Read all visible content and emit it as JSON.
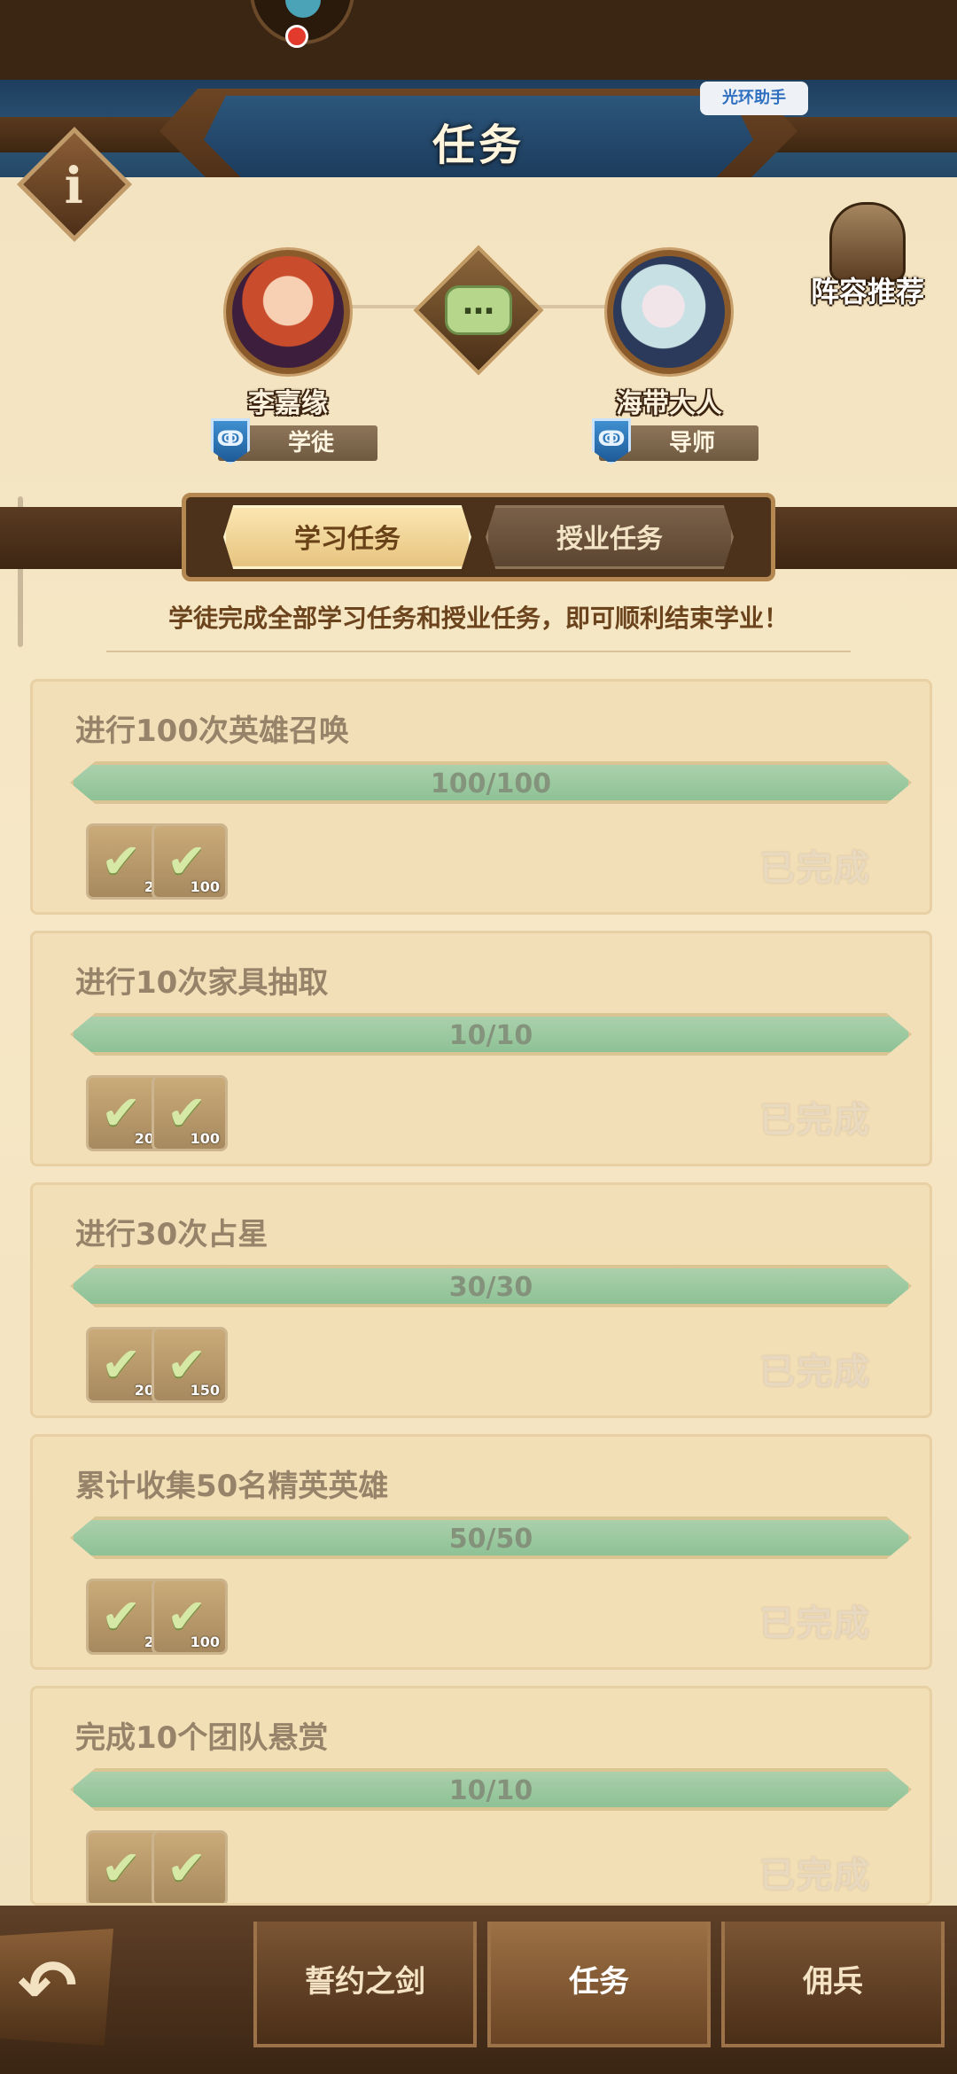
{
  "header": {
    "title": "任务",
    "helper_label": "光环助手",
    "lineup_label": "阵容推荐"
  },
  "apprentice": {
    "name": "李嘉缘",
    "role": "学徒"
  },
  "mentor": {
    "name": "海带大人",
    "role": "导师"
  },
  "tabs": [
    {
      "label": "学习任务",
      "active": true
    },
    {
      "label": "授业任务",
      "active": false
    }
  ],
  "subtitle": "学徒完成全部学习任务和授业任务，即可顺利结束学业！",
  "tasks": [
    {
      "name": "进行100次英雄召唤",
      "progress": "100/100",
      "rewards": [
        "2",
        "100"
      ],
      "status": "已完成"
    },
    {
      "name": "进行10次家具抽取",
      "progress": "10/10",
      "rewards": [
        "20",
        "100"
      ],
      "status": "已完成"
    },
    {
      "name": "进行30次占星",
      "progress": "30/30",
      "rewards": [
        "20",
        "150"
      ],
      "status": "已完成"
    },
    {
      "name": "累计收集50名精英英雄",
      "progress": "50/50",
      "rewards": [
        "2",
        "100"
      ],
      "status": "已完成"
    },
    {
      "name": "完成10个团队悬赏",
      "progress": "10/10",
      "rewards": [
        "",
        ""
      ],
      "status": "已完成"
    }
  ],
  "bottom_nav": [
    {
      "label": "誓约之剑",
      "active": false
    },
    {
      "label": "任务",
      "active": true
    },
    {
      "label": "佣兵",
      "active": false
    }
  ]
}
